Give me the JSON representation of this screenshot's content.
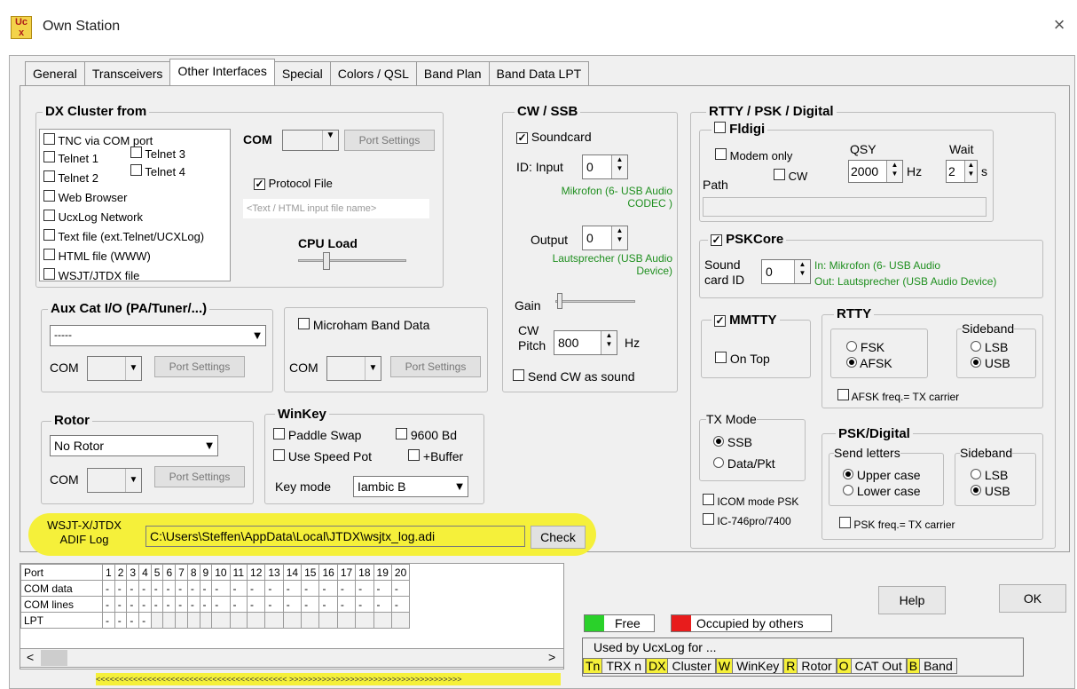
{
  "window": {
    "title": "Own Station",
    "icon": "ucx-app-icon",
    "close": "×"
  },
  "tabs": [
    "General",
    "Transceivers",
    "Other Interfaces",
    "Special",
    "Colors / QSL",
    "Band Plan",
    "Band Data LPT"
  ],
  "dx": {
    "title": "DX Cluster from",
    "items": [
      "TNC via COM port",
      "Telnet 1",
      "Telnet 2",
      "Web Browser",
      "UcxLog Network",
      "Text file (ext.Telnet/UCXLog)",
      "HTML file (WWW)",
      "WSJT/JTDX file"
    ],
    "telnet3": "Telnet 3",
    "telnet4": "Telnet 4",
    "com_label": "COM",
    "port_settings": "Port Settings",
    "protocol": "Protocol File",
    "input_placeholder": "<Text / HTML input file name>",
    "cpu": "CPU Load"
  },
  "aux": {
    "title": "Aux Cat I/O (PA/Tuner/...)",
    "value": "-----",
    "com": "COM",
    "port_settings": "Port Settings"
  },
  "microham": {
    "label": "Microham Band Data",
    "com": "COM",
    "port_settings": "Port Settings"
  },
  "rotor": {
    "title": "Rotor",
    "value": "No Rotor",
    "com": "COM",
    "port_settings": "Port Settings"
  },
  "winkey": {
    "title": "WinKey",
    "paddle": "Paddle Swap",
    "bd": "9600 Bd",
    "speed": "Use Speed Pot",
    "buffer": "+Buffer",
    "keymode": "Key mode",
    "keyvalue": "Iambic B"
  },
  "wsjt": {
    "label1": "WSJT-X/JTDX",
    "label2": "ADIF Log",
    "path": "C:\\Users\\Steffen\\AppData\\Local\\JTDX\\wsjtx_log.adi",
    "check": "Check"
  },
  "cw": {
    "title": "CW / SSB",
    "soundcard": "Soundcard",
    "id_input": "ID: Input",
    "input_val": "0",
    "mic": "Mikrofon (6- USB Audio",
    "mic2": "CODEC )",
    "output": "Output",
    "output_val": "0",
    "speaker": "Lautsprecher (USB Audio",
    "speaker2": "Device)",
    "gain": "Gain",
    "pitch1": "CW",
    "pitch2": "Pitch",
    "pitch_val": "800",
    "hz": "Hz",
    "sendcw": "Send CW as sound"
  },
  "rtty": {
    "title": "RTTY / PSK / Digital",
    "fldigi": "Fldigi",
    "modem": "Modem only",
    "cwlbl": "CW",
    "qsy": "QSY",
    "qsy_val": "2000",
    "hz": "Hz",
    "wait": "Wait",
    "wait_val": "2",
    "s": "s",
    "path": "Path",
    "pskcore": "PSKCore",
    "sound": "Sound",
    "cardid": "card ID",
    "card_val": "0",
    "in": "In: Mikrofon (6- USB Audio",
    "out": "Out: Lautsprecher (USB Audio Device)",
    "mmtty": "MMTTY",
    "ontop": "On Top",
    "rtty_title": "RTTY",
    "fsk": "FSK",
    "afsk": "AFSK",
    "sideband": "Sideband",
    "lsb": "LSB",
    "usb": "USB",
    "afsk_freq": "AFSK freq.= TX carrier",
    "txmode": "TX Mode",
    "ssb": "SSB",
    "datapkt": "Data/Pkt",
    "icom": "ICOM mode PSK",
    "ic746": "IC-746pro/7400",
    "psk_title": "PSK/Digital",
    "send": "Send letters",
    "upper": "Upper case",
    "lower": "Lower case",
    "psk_freq": "PSK freq.= TX carrier"
  },
  "ports": {
    "header": [
      "Port",
      "1",
      "2",
      "3",
      "4",
      "5",
      "6",
      "7",
      "8",
      "9",
      "10",
      "11",
      "12",
      "13",
      "14",
      "15",
      "16",
      "17",
      "18",
      "19",
      "20"
    ],
    "rows": [
      {
        "label": "COM data",
        "cells": 20
      },
      {
        "label": "COM lines",
        "cells": 20
      },
      {
        "label": "LPT",
        "cells": 4
      }
    ],
    "dash": "-",
    "arrows": "<<<<<<<<<<<<<<<<<<<<<<<<<<<<<<<<<<<<<<<<< >>>>>>>>>>>>>>>>>>>>>>>>>>>>>>>>>>>>>"
  },
  "legend": {
    "free": "Free",
    "occupied": "Occupied by others",
    "used": "Used by UcxLog for ...",
    "codes": [
      {
        "k": "Tn",
        "v": "TRX n"
      },
      {
        "k": "DX",
        "v": "Cluster"
      },
      {
        "k": "W",
        "v": "WinKey"
      },
      {
        "k": "R",
        "v": "Rotor"
      },
      {
        "k": "O",
        "v": "CAT Out"
      },
      {
        "k": "B",
        "v": "Band"
      }
    ]
  },
  "help": "Help",
  "ok": "OK"
}
